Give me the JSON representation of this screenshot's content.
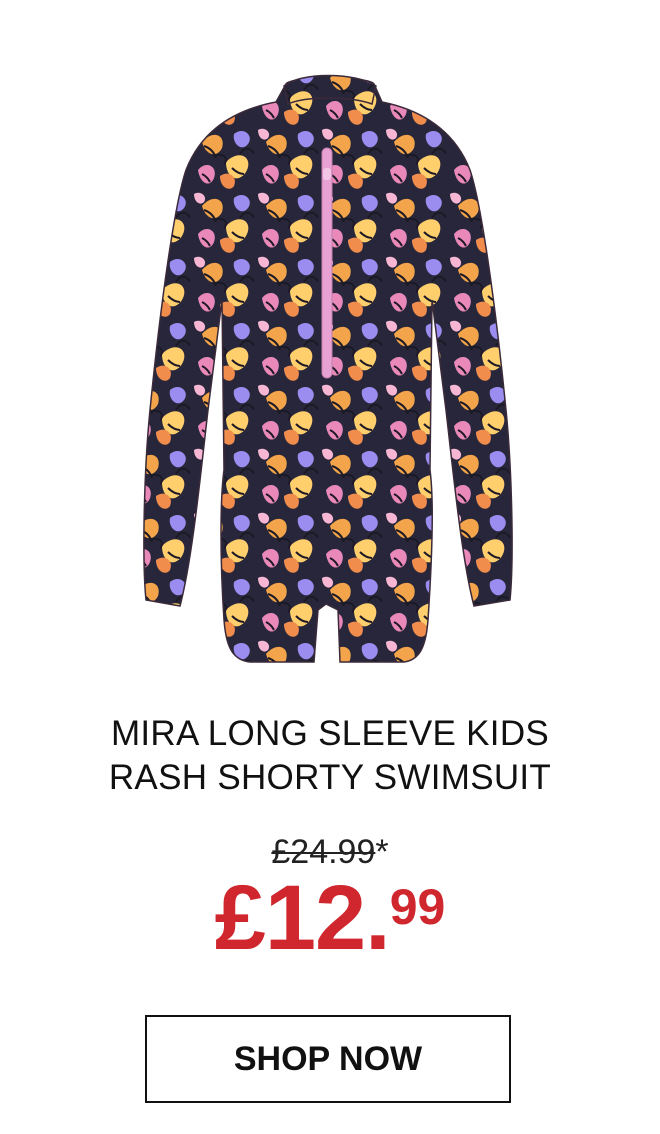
{
  "product": {
    "title_line1": "MIRA LONG SLEEVE KIDS",
    "title_line2": "RASH SHORTY SWIMSUIT",
    "image_icon": "floral-rash-suit-image",
    "zip_color": "#e7a2d3",
    "pattern_colors": [
      "#25232f",
      "#f2a94b",
      "#e889b9",
      "#9b8cf0",
      "#ffcf6d"
    ]
  },
  "price": {
    "was": "£24.99",
    "was_marker": "*",
    "now_main": "£12.",
    "now_pence": "99",
    "now_color": "#d0262d"
  },
  "cta": {
    "label": "SHOP NOW"
  }
}
